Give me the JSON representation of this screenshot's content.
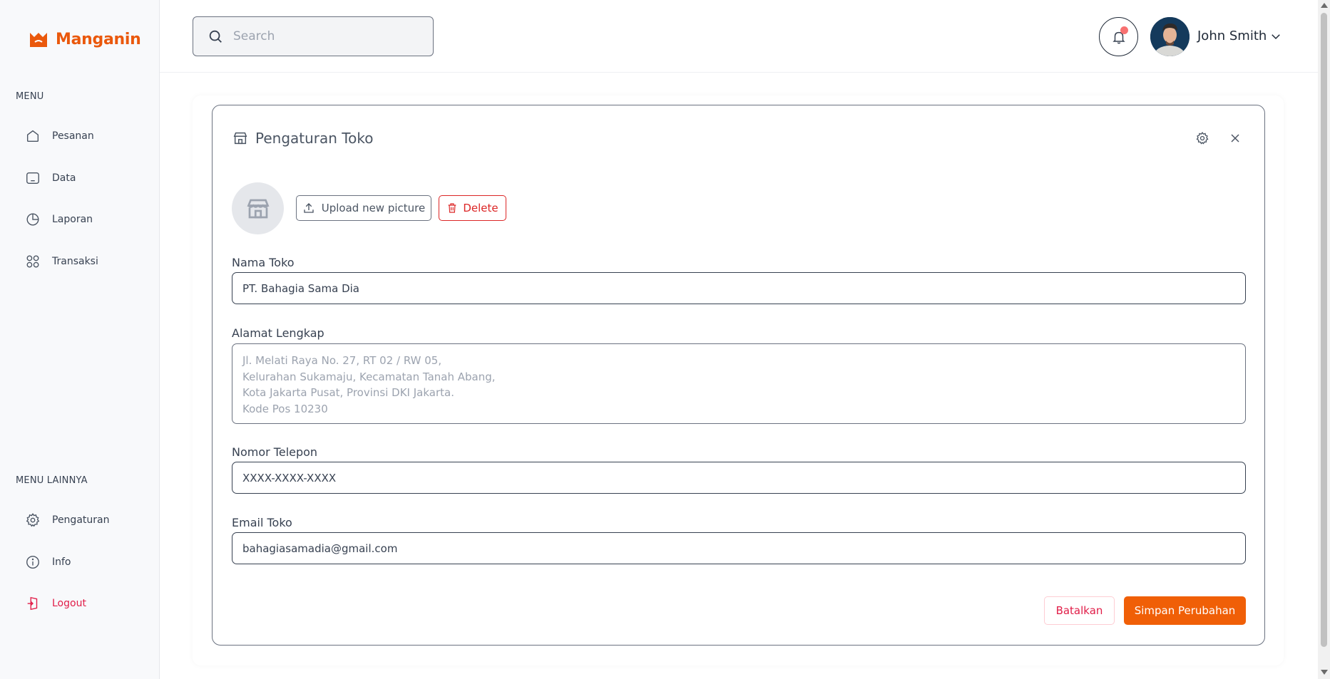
{
  "app": {
    "name": "Manganin",
    "brand_color": "#ea580c"
  },
  "sidebar": {
    "menu_heading": "MENU",
    "items": [
      {
        "label": "Pesanan",
        "icon": "home-icon"
      },
      {
        "label": "Data",
        "icon": "monitor-icon"
      },
      {
        "label": "Laporan",
        "icon": "pie-chart-icon"
      },
      {
        "label": "Transaksi",
        "icon": "grid-circles-icon"
      }
    ],
    "other_heading": "MENU LAINNYA",
    "other_items": [
      {
        "label": "Pengaturan",
        "icon": "gear-icon"
      },
      {
        "label": "Info",
        "icon": "info-icon"
      },
      {
        "label": "Logout",
        "icon": "logout-icon"
      }
    ]
  },
  "header": {
    "search_placeholder": "Search",
    "user_name": "John Smith",
    "notification_dot_color": "#f87171"
  },
  "panel": {
    "title": "Pengaturan Toko",
    "upload_label": "Upload new picture",
    "delete_label": "Delete",
    "fields": {
      "store_name_label": "Nama Toko",
      "store_name_value": "PT. Bahagia Sama Dia",
      "address_label": "Alamat Lengkap",
      "address_placeholder": "Jl. Melati Raya No. 27, RT 02 / RW 05,\nKelurahan Sukamaju, Kecamatan Tanah Abang,\nKota Jakarta Pusat, Provinsi DKI Jakarta.\nKode Pos 10230",
      "phone_label": "Nomor Telepon",
      "phone_value": "XXXX-XXXX-XXXX",
      "email_label": "Email Toko",
      "email_value": "bahagiasamadia@gmail.com"
    },
    "cancel_label": "Batalkan",
    "save_label": "Simpan Perubahan",
    "save_color": "#f05f07"
  }
}
